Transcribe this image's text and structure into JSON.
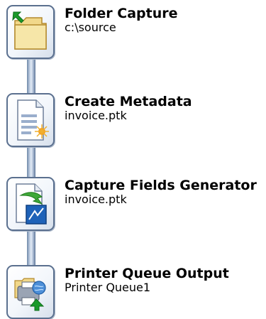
{
  "steps": [
    {
      "title": "Folder Capture",
      "subtitle": "c:\\source",
      "icon": "folder-capture-icon"
    },
    {
      "title": "Create Metadata",
      "subtitle": "invoice.ptk",
      "icon": "create-metadata-icon"
    },
    {
      "title": "Capture Fields Generator",
      "subtitle": "invoice.ptk",
      "icon": "capture-fields-generator-icon"
    },
    {
      "title": "Printer Queue Output",
      "subtitle": "Printer Queue1",
      "icon": "printer-queue-output-icon"
    }
  ],
  "colors": {
    "connector": "#8fa6c4",
    "tile_border": "#5b708f"
  }
}
